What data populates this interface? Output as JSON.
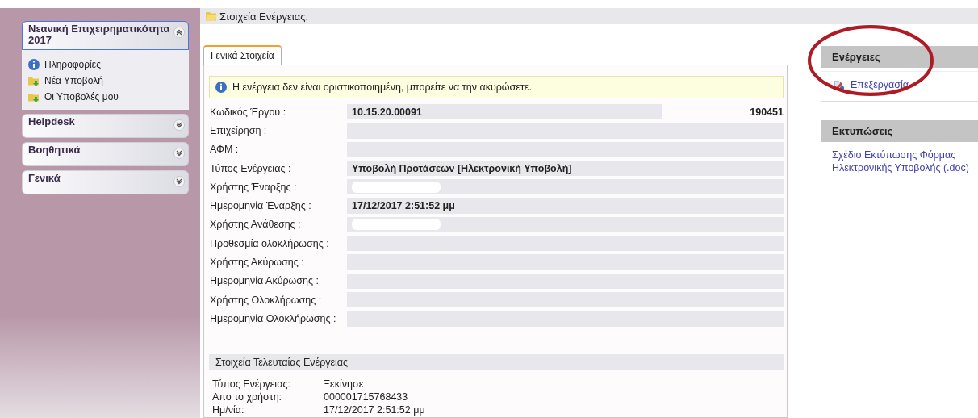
{
  "sidebar": {
    "panels": [
      {
        "title": "Νεανική Επιχειρηματικότητα 2017",
        "expanded": true,
        "selected": true,
        "items": [
          {
            "label": "Πληροφορίες",
            "kind": "info"
          },
          {
            "label": "Νέα Υποβολή",
            "kind": "folder"
          },
          {
            "label": "Οι Υποβολές μου",
            "kind": "folder"
          }
        ]
      },
      {
        "title": "Helpdesk",
        "expanded": false,
        "selected": false
      },
      {
        "title": "Βοηθητικά",
        "expanded": false,
        "selected": false
      },
      {
        "title": "Γενικά",
        "expanded": false,
        "selected": false
      }
    ]
  },
  "header": {
    "title": "Στοιχεία Ενέργειας."
  },
  "tabs": [
    {
      "label": "Γενικά Στοιχεία",
      "selected": true
    }
  ],
  "notice": "Η ενέργεια δεν είναι οριστικοποιημένη, μπορείτε να την ακυρώσετε.",
  "fields": [
    {
      "label": "Κωδικός Έργου :",
      "value": "10.15.20.00091",
      "extra": "190451"
    },
    {
      "label": "Επιχείρηση :"
    },
    {
      "label": "ΑΦΜ :"
    },
    {
      "label": "Τύπος Ενέργειας :",
      "value": "Υποβολή Προτάσεων [Ηλεκτρονική Υποβολή]"
    },
    {
      "label": "Χρήστης Έναρξης :",
      "redacted": true
    },
    {
      "label": "Ημερομηνία Έναρξης :",
      "value": "17/12/2017 2:51:52 μμ"
    },
    {
      "label": "Χρήστης Ανάθεσης :",
      "redacted": true
    },
    {
      "label": "Προθεσμία ολοκλήρωσης :"
    },
    {
      "label": "Χρήστης Ακύρωσης :"
    },
    {
      "label": "Ημερομηνία Ακύρωσης :"
    },
    {
      "label": "Χρήστης Ολοκλήρωσης :"
    },
    {
      "label": "Ημερομηνία Ολοκλήρωσης :"
    }
  ],
  "last_action": {
    "title": "Στοιχεία Τελευταίας Ενέργειας",
    "rows": [
      {
        "label": "Τύπος Ενέργειας:",
        "value": "Ξεκίνησε"
      },
      {
        "label": "Απο το χρήστη:",
        "value": "000001715768433"
      },
      {
        "label": "Ημ/νία:",
        "value": "17/12/2017 2:51:52 μμ"
      }
    ]
  },
  "right_panels": [
    {
      "title": "Ενέργειες",
      "links": [
        {
          "label": "Επεξεργασία",
          "kind": "edit"
        }
      ],
      "circled": true
    },
    {
      "title": "Εκτυπώσεις",
      "links": [
        {
          "label": "Σχέδιο Εκτύπωσης Φόρμας Ηλεκτρονικής Υποβολής (.doc)",
          "kind": "plain"
        }
      ],
      "circled": false
    }
  ]
}
